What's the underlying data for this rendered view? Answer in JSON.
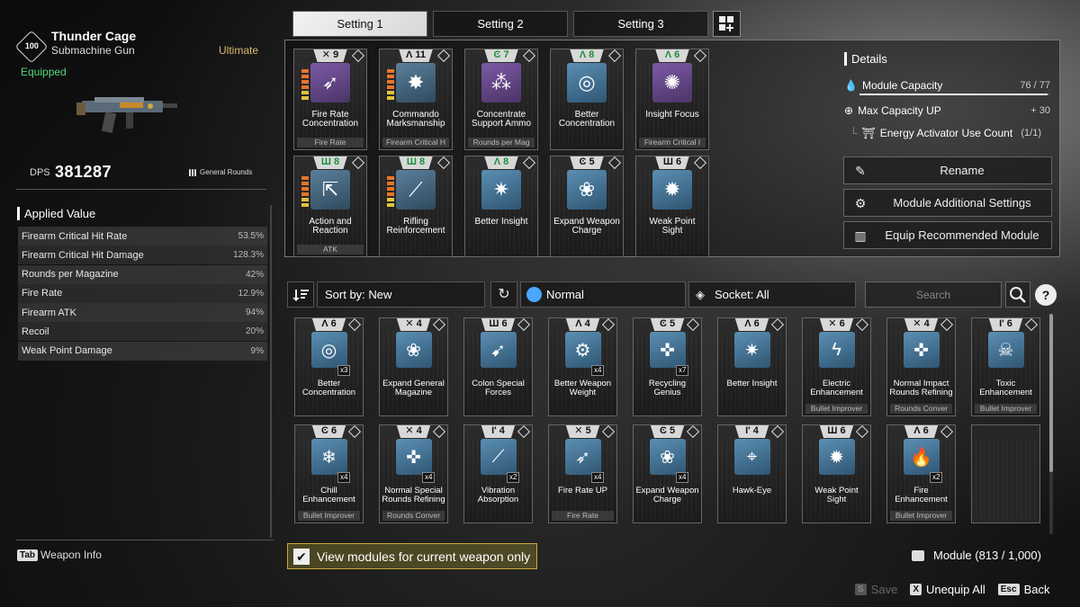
{
  "weapon": {
    "level": "100",
    "name": "Thunder Cage",
    "type": "Submachine Gun",
    "tier": "Ultimate",
    "status": "Equipped",
    "dps_label": "DPS",
    "dps_value": "381287",
    "ammo_type": "General Rounds"
  },
  "applied_value": {
    "title": "Applied Value",
    "rows": [
      {
        "label": "Firearm Critical Hit Rate",
        "value": "53.5%"
      },
      {
        "label": "Firearm Critical Hit Damage",
        "value": "128.3%"
      },
      {
        "label": "Rounds per Magazine",
        "value": "42%"
      },
      {
        "label": "Fire Rate",
        "value": "12.9%"
      },
      {
        "label": "Firearm ATK",
        "value": "94%"
      },
      {
        "label": "Recoil",
        "value": "20%"
      },
      {
        "label": "Weak Point Damage",
        "value": "9%"
      }
    ]
  },
  "weapon_info": {
    "key": "Tab",
    "label": "Weapon Info"
  },
  "tabs": [
    {
      "label": "Setting 1",
      "active": true
    },
    {
      "label": "Setting 2",
      "active": false
    },
    {
      "label": "Setting 3",
      "active": false
    }
  ],
  "equipped_modules": [
    {
      "cost": "9",
      "cost_icon": "✕",
      "name": "Fire Rate Concentration",
      "sub": "Fire Rate",
      "art": "purple",
      "glyph": "➶",
      "bars": true
    },
    {
      "cost": "11",
      "cost_icon": "Λ",
      "name": "Commando Marksmanship",
      "sub": "Firearm Critical H",
      "art": "orange",
      "glyph": "✸",
      "bars": true
    },
    {
      "cost": "7",
      "cost_icon": "Ͼ",
      "name": "Concentrate Support Ammo",
      "sub": "Rounds per Mag",
      "art": "purple",
      "glyph": "⁂",
      "green": true
    },
    {
      "cost": "8",
      "cost_icon": "Λ",
      "name": "Better Concentration",
      "sub": "",
      "art": "blue",
      "glyph": "◎",
      "green": true
    },
    {
      "cost": "6",
      "cost_icon": "Λ",
      "name": "Insight Focus",
      "sub": "Firearm Critical I",
      "art": "purple",
      "glyph": "✺",
      "green": true
    },
    {
      "cost": "8",
      "cost_icon": "Ш",
      "name": "Action and Reaction",
      "sub": "ATK",
      "art": "orange",
      "glyph": "⇱",
      "bars": true,
      "green": true
    },
    {
      "cost": "8",
      "cost_icon": "Ш",
      "name": "Rifling Reinforcement",
      "sub": "",
      "art": "orange",
      "glyph": "⟋",
      "bars": true,
      "green": true
    },
    {
      "cost": "8",
      "cost_icon": "Λ",
      "name": "Better Insight",
      "sub": "",
      "art": "blue",
      "glyph": "✷",
      "green": true
    },
    {
      "cost": "5",
      "cost_icon": "Ͼ",
      "name": "Expand Weapon Charge",
      "sub": "",
      "art": "blue",
      "glyph": "❀"
    },
    {
      "cost": "6",
      "cost_icon": "Ш",
      "name": "Weak Point Sight",
      "sub": "",
      "art": "blue",
      "glyph": "✹"
    }
  ],
  "details": {
    "title": "Details",
    "capacity_label": "Module Capacity",
    "capacity_value": "76 / 77",
    "capacity_fraction": 0.987,
    "max_capacity_label": "Max Capacity UP",
    "max_capacity_value": "+ 30",
    "activator_label": "Energy Activator Use Count",
    "activator_value": "(1/1)",
    "rename": "Rename",
    "additional_settings": "Module Additional Settings",
    "equip_recommended": "Equip Recommended Module"
  },
  "filters": {
    "sort": "Sort by: New",
    "rarity": "Normal",
    "socket": "Socket: All",
    "search_placeholder": "Search"
  },
  "inventory_modules": [
    {
      "cost": "6",
      "cost_icon": "Λ",
      "name": "Better Concentration",
      "sub": "",
      "qty": "x3",
      "glyph": "◎"
    },
    {
      "cost": "4",
      "cost_icon": "✕",
      "name": "Expand General Magazine",
      "sub": "",
      "qty": "",
      "glyph": "❀"
    },
    {
      "cost": "6",
      "cost_icon": "Ш",
      "name": "Colon Special Forces",
      "sub": "",
      "qty": "",
      "glyph": "➹"
    },
    {
      "cost": "4",
      "cost_icon": "Λ",
      "name": "Better Weapon Weight",
      "sub": "",
      "qty": "x4",
      "glyph": "⚙"
    },
    {
      "cost": "5",
      "cost_icon": "Ͼ",
      "name": "Recycling Genius",
      "sub": "",
      "qty": "x7",
      "glyph": "✜"
    },
    {
      "cost": "6",
      "cost_icon": "Λ",
      "name": "Better Insight",
      "sub": "",
      "qty": "",
      "glyph": "✷"
    },
    {
      "cost": "6",
      "cost_icon": "✕",
      "name": "Electric Enhancement",
      "sub": "Bullet Improver",
      "qty": "",
      "glyph": "ϟ"
    },
    {
      "cost": "4",
      "cost_icon": "✕",
      "name": "Normal Impact Rounds Refining",
      "sub": "Rounds Conver",
      "qty": "",
      "glyph": "✜"
    },
    {
      "cost": "6",
      "cost_icon": "Ι'",
      "name": "Toxic Enhancement",
      "sub": "Bullet Improver",
      "qty": "",
      "glyph": "☠"
    },
    {
      "cost": "6",
      "cost_icon": "Ͼ",
      "name": "Chill Enhancement",
      "sub": "Bullet Improver",
      "qty": "x4",
      "glyph": "❄"
    },
    {
      "cost": "4",
      "cost_icon": "✕",
      "name": "Normal Special Rounds Refining",
      "sub": "Rounds Conver",
      "qty": "x4",
      "glyph": "✜"
    },
    {
      "cost": "4",
      "cost_icon": "Ι'",
      "name": "Vibration Absorption",
      "sub": "",
      "qty": "x2",
      "glyph": "⟋"
    },
    {
      "cost": "5",
      "cost_icon": "✕",
      "name": "Fire Rate UP",
      "sub": "Fire Rate",
      "qty": "x4",
      "glyph": "➶"
    },
    {
      "cost": "5",
      "cost_icon": "Ͼ",
      "name": "Expand Weapon Charge",
      "sub": "",
      "qty": "x4",
      "glyph": "❀"
    },
    {
      "cost": "4",
      "cost_icon": "Ι'",
      "name": "Hawk-Eye",
      "sub": "",
      "qty": "",
      "glyph": "⌖"
    },
    {
      "cost": "6",
      "cost_icon": "Ш",
      "name": "Weak Point Sight",
      "sub": "",
      "qty": "",
      "glyph": "✹"
    },
    {
      "cost": "6",
      "cost_icon": "Λ",
      "name": "Fire Enhancement",
      "sub": "Bullet Improver",
      "qty": "x2",
      "glyph": "🔥"
    }
  ],
  "view_current": "View modules for current weapon only",
  "module_count": "Module (813 / 1,000)",
  "footer": {
    "save_key": "S",
    "save": "Save",
    "unequip_key": "X",
    "unequip": "Unequip All",
    "back_key": "Esc",
    "back": "Back"
  }
}
